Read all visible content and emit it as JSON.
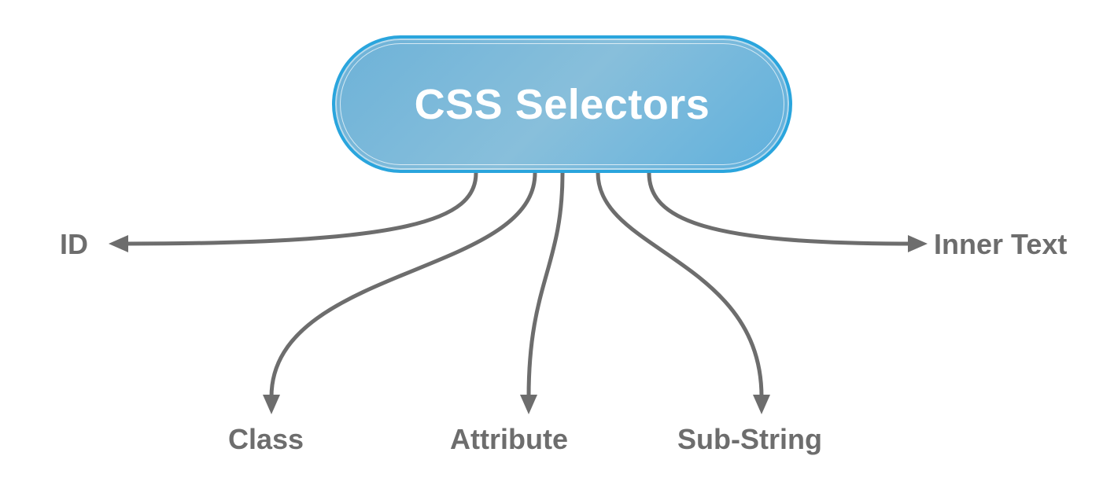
{
  "root": {
    "title": "CSS Selectors"
  },
  "branches": {
    "id": "ID",
    "class": "Class",
    "attribute": "Attribute",
    "substring": "Sub-String",
    "innertext": "Inner Text"
  },
  "colors": {
    "node_gradient_start": "#6db2d8",
    "node_gradient_end": "#5fb0dd",
    "node_border": "#2aa5dd",
    "label_color": "#6d6d6d",
    "arrow_color": "#6d6d6d"
  }
}
